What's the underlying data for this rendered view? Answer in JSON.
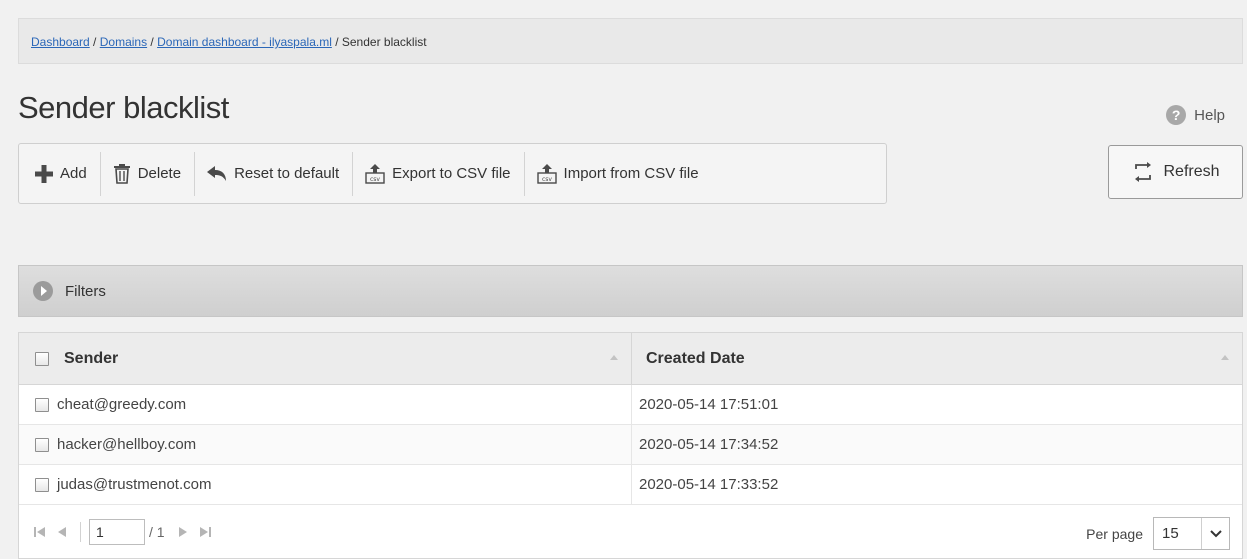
{
  "breadcrumb": {
    "items": [
      "Dashboard",
      "Domains",
      "Domain dashboard - ilyaspala.ml"
    ],
    "current": "Sender blacklist",
    "separator": " / "
  },
  "page": {
    "title": "Sender blacklist"
  },
  "help": {
    "label": "Help",
    "icon": "help-icon"
  },
  "toolbar": {
    "add": "Add",
    "delete": "Delete",
    "reset": "Reset to default",
    "export": "Export to CSV file",
    "import": "Import from CSV file"
  },
  "refresh": {
    "label": "Refresh"
  },
  "filters": {
    "label": "Filters"
  },
  "table": {
    "columns": [
      "Sender",
      "Created Date"
    ],
    "rows": [
      {
        "sender": "cheat@greedy.com",
        "created": "2020-05-14 17:51:01"
      },
      {
        "sender": "hacker@hellboy.com",
        "created": "2020-05-14 17:34:52"
      },
      {
        "sender": "judas@trustmenot.com",
        "created": "2020-05-14 17:33:52"
      }
    ]
  },
  "pagination": {
    "current_page": "1",
    "total": "/ 1",
    "per_page_label": "Per page",
    "per_page_value": "15"
  },
  "colors": {
    "link": "#2b67b8",
    "icon": "#555555"
  }
}
